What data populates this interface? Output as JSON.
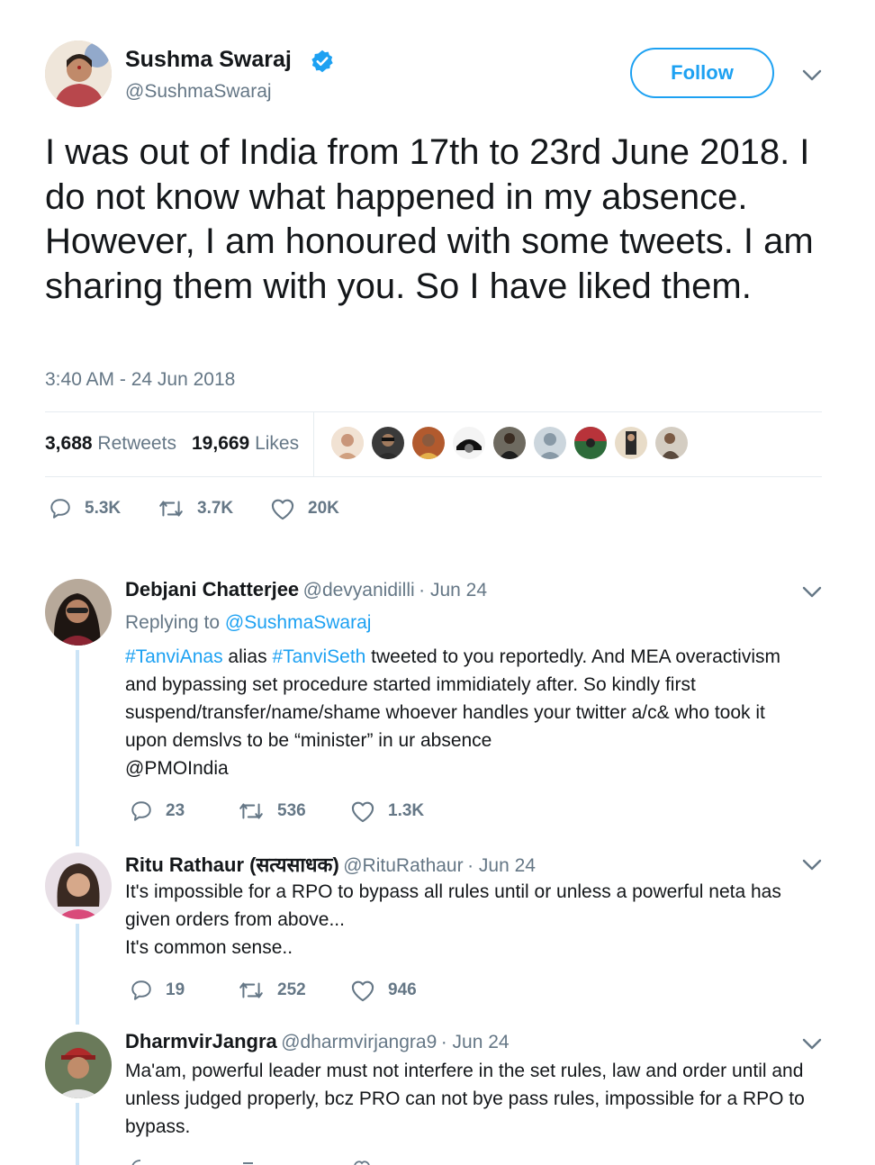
{
  "colors": {
    "accent": "#1da1f2",
    "muted": "#657786",
    "text": "#14171a",
    "thread": "#cce4f6"
  },
  "main_tweet": {
    "author_name": "Sushma Swaraj",
    "author_handle": "@SushmaSwaraj",
    "verified": true,
    "follow_label": "Follow",
    "text": "I was out of India from 17th to 23rd June 2018. I do not know what happened in my absence. However, I am honoured with some tweets. I am sharing them with you. So I have liked them.",
    "timestamp": "3:40 AM - 24 Jun 2018",
    "retweet_count": "3,688",
    "retweet_label": "Retweets",
    "like_count": "19,669",
    "like_label": "Likes",
    "actions": {
      "replies": "5.3K",
      "retweets": "3.7K",
      "likes": "20K"
    }
  },
  "replies": [
    {
      "author_name": "Debjani Chatterjee",
      "author_handle": "@devyanidilli",
      "date": "· Jun 24",
      "replying_to_label": "Replying to",
      "replying_to_handle": "@SushmaSwaraj",
      "hashtag1": "#TanviAnas",
      "mid1": " alias ",
      "hashtag2": "#TanviSeth",
      "text_rest": " tweeted to you reportedly. And MEA overactivism and bypassing set procedure started immidiately after. So kindly first suspend/transfer/name/shame whoever handles your twitter a/c& who took it upon demslvs to be “minister” in ur absence",
      "mention": "@PMOIndia",
      "replies": "23",
      "retweets": "536",
      "likes": "1.3K"
    },
    {
      "author_name": "Ritu Rathaur (सत्यसाधक)",
      "author_handle": "@RituRathaur",
      "date": "· Jun 24",
      "line1": "It's impossible for a RPO to bypass all rules until or unless a powerful neta has given orders from above...",
      "line2": "It's common sense..",
      "replies": "19",
      "retweets": "252",
      "likes": "946"
    },
    {
      "author_name": "DharmvirJangra",
      "author_handle": "@dharmvirjangra9",
      "date": "· Jun 24",
      "text": "Ma'am, powerful leader must not interfere in the set rules, law and order until and unless judged properly, bcz PRO can not bye pass rules, impossible for a RPO to bypass."
    }
  ]
}
